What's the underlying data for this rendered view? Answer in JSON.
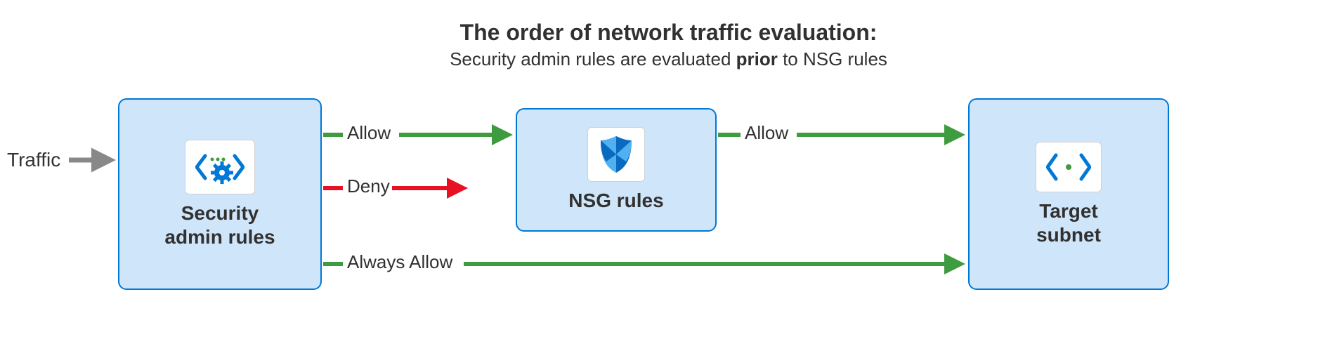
{
  "title": "The order of network traffic evaluation:",
  "subtitle_pre": "Security admin rules are evaluated ",
  "subtitle_bold": "prior",
  "subtitle_post": " to NSG rules",
  "traffic_label": "Traffic",
  "boxes": {
    "security": {
      "label_line1": "Security",
      "label_line2": "admin rules"
    },
    "nsg": {
      "label": "NSG rules"
    },
    "target": {
      "label_line1": "Target",
      "label_line2": "subnet"
    }
  },
  "arrows": {
    "allow1": "Allow",
    "deny": "Deny",
    "allow2": "Allow",
    "always": "Always Allow"
  },
  "colors": {
    "green": "#3f9b3f",
    "red": "#e81123",
    "gray": "#888888",
    "azure_blue": "#0078d4",
    "shield_light": "#50b0f0",
    "shield_dark": "#0a6abf"
  }
}
